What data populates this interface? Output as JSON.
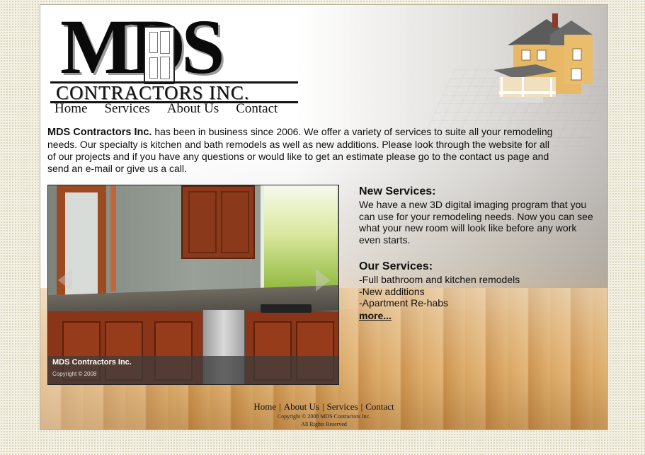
{
  "logo": {
    "main": "MDS",
    "sub": "CONTRACTORS INC."
  },
  "nav": [
    "Home",
    "Services",
    "About Us",
    "Contact"
  ],
  "intro": {
    "company": "MDS Contractors Inc.",
    "text": " has been in business since 2006. We offer a variety of services to suite all your remodeling needs. Our specialty is kitchen and bath remodels as well as new additions. Please look through the website for all of our projects and if you have any questions or would like to get an estimate please go to the contact us page and send an e-mail or give us a call."
  },
  "slideshow": {
    "caption_title": "MDS Contractors Inc.",
    "caption_copyright": "Copyright © 2008"
  },
  "new_services": {
    "heading": "New Services:",
    "text": "We have a new 3D digital imaging program that you can use for your remodeling needs. Now you can see what your new room will look like before any work even starts."
  },
  "our_services": {
    "heading": "Our Services:",
    "items": [
      "-Full bathroom and kitchen remodels",
      "-New additions",
      "-Apartment Re-habs"
    ],
    "more": "more..."
  },
  "footer": {
    "links": [
      "Home",
      "About Us",
      "Services",
      "Contact"
    ],
    "copyright": "Copyright © 2008 MDS Contractors Inc.",
    "rights": "All Rights Reserved"
  }
}
